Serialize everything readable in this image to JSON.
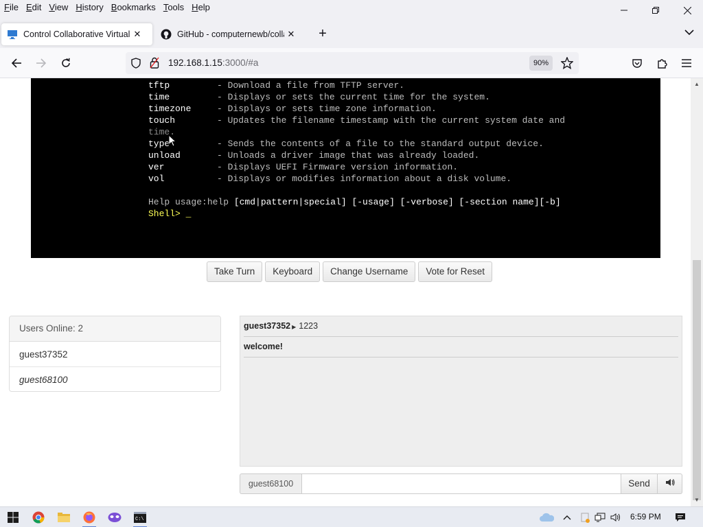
{
  "menu": {
    "items": [
      {
        "label": "File",
        "key": "F",
        "rest": "ile"
      },
      {
        "label": "Edit",
        "key": "E",
        "rest": "dit"
      },
      {
        "label": "View",
        "key": "V",
        "rest": "iew"
      },
      {
        "label": "History",
        "key": "H",
        "rest": "istory"
      },
      {
        "label": "Bookmarks",
        "key": "B",
        "rest": "ookmarks"
      },
      {
        "label": "Tools",
        "key": "T",
        "rest": "ools"
      },
      {
        "label": "Help",
        "key": "H",
        "rest": "elp"
      }
    ]
  },
  "tabs": [
    {
      "title": "Control Collaborative Virtual Ma",
      "icon": "monitor-icon",
      "active": true
    },
    {
      "title": "GitHub - computernewb/collab",
      "icon": "github-icon",
      "active": false
    }
  ],
  "address": {
    "host": "192.168.1.15",
    "rest": ":3000/#a",
    "zoom": "90%"
  },
  "terminal": {
    "commands": [
      {
        "cmd": "tftp",
        "desc": "- Download a file from TFTP server."
      },
      {
        "cmd": "time",
        "desc": "- Displays or sets the current time for the system."
      },
      {
        "cmd": "timezone",
        "desc": "- Displays or sets time zone information."
      },
      {
        "cmd": "touch",
        "desc": "- Updates the filename timestamp with the current system date and"
      },
      {
        "cmd": "",
        "desc": "time."
      },
      {
        "cmd": "type",
        "desc": "- Sends the contents of a file to the standard output device."
      },
      {
        "cmd": "unload",
        "desc": "- Unloads a driver image that was already loaded."
      },
      {
        "cmd": "ver",
        "desc": "- Displays UEFI Firmware version information."
      },
      {
        "cmd": "vol",
        "desc": "- Displays or modifies information about a disk volume."
      }
    ],
    "help_prefix": "Help usage:help ",
    "help_args": "[cmd|pattern|special] [-usage] [-verbose] [-section name][-b]",
    "prompt": "Shell> _"
  },
  "controls": {
    "take_turn": "Take Turn",
    "keyboard": "Keyboard",
    "change_username": "Change Username",
    "vote_reset": "Vote for Reset"
  },
  "users": {
    "header": "Users Online: 2",
    "list": [
      {
        "name": "guest37352",
        "italic": false
      },
      {
        "name": "guest68100",
        "italic": true
      }
    ]
  },
  "chat": {
    "messages": [
      {
        "user": "guest37352",
        "text": "1223"
      },
      {
        "user": "",
        "text": "welcome!"
      }
    ],
    "username": "guest68100",
    "input_value": "",
    "send_label": "Send"
  },
  "taskbar": {
    "time": "6:59 PM"
  },
  "colors": {
    "terminal_bg": "#000000",
    "prompt": "#ffff55",
    "accent": "#5a7fd1"
  }
}
